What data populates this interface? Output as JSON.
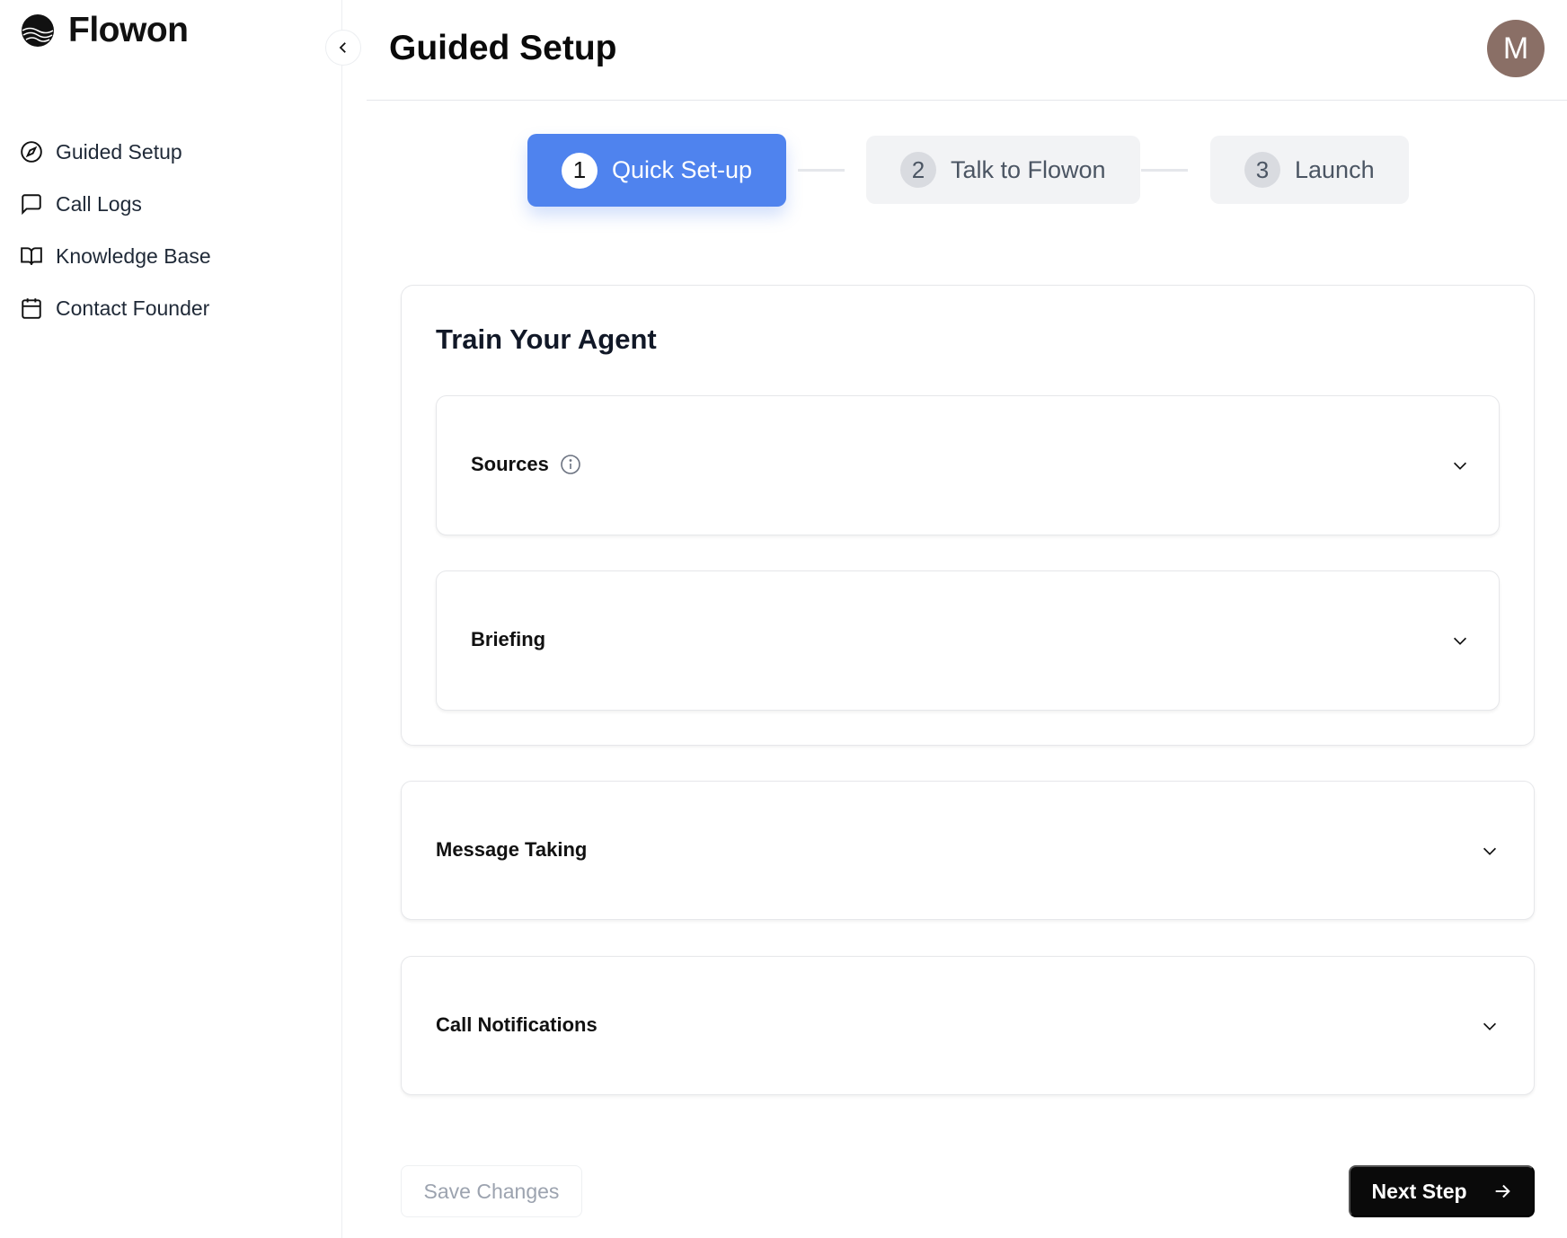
{
  "brand": {
    "name": "Flowon",
    "logo_icon": "wave-sphere-icon"
  },
  "sidebar": {
    "items": [
      {
        "label": "Guided Setup",
        "icon": "compass-icon"
      },
      {
        "label": "Call Logs",
        "icon": "message-square-icon"
      },
      {
        "label": "Knowledge Base",
        "icon": "book-open-icon"
      },
      {
        "label": "Contact Founder",
        "icon": "calendar-icon"
      }
    ]
  },
  "header": {
    "title": "Guided Setup",
    "avatar_initial": "M",
    "avatar_color": "#8a6f66"
  },
  "stepper": {
    "steps": [
      {
        "number": "1",
        "label": "Quick Set-up",
        "active": true
      },
      {
        "number": "2",
        "label": "Talk to Flowon",
        "active": false
      },
      {
        "number": "3",
        "label": "Launch",
        "active": false
      }
    ],
    "accent": "#4f83ee"
  },
  "train": {
    "title": "Train Your Agent",
    "sections": [
      {
        "label": "Sources",
        "has_info": true
      },
      {
        "label": "Briefing",
        "has_info": false
      }
    ]
  },
  "sections": [
    {
      "label": "Message Taking"
    },
    {
      "label": "Call Notifications"
    }
  ],
  "footer": {
    "save_label": "Save Changes",
    "next_label": "Next Step"
  }
}
